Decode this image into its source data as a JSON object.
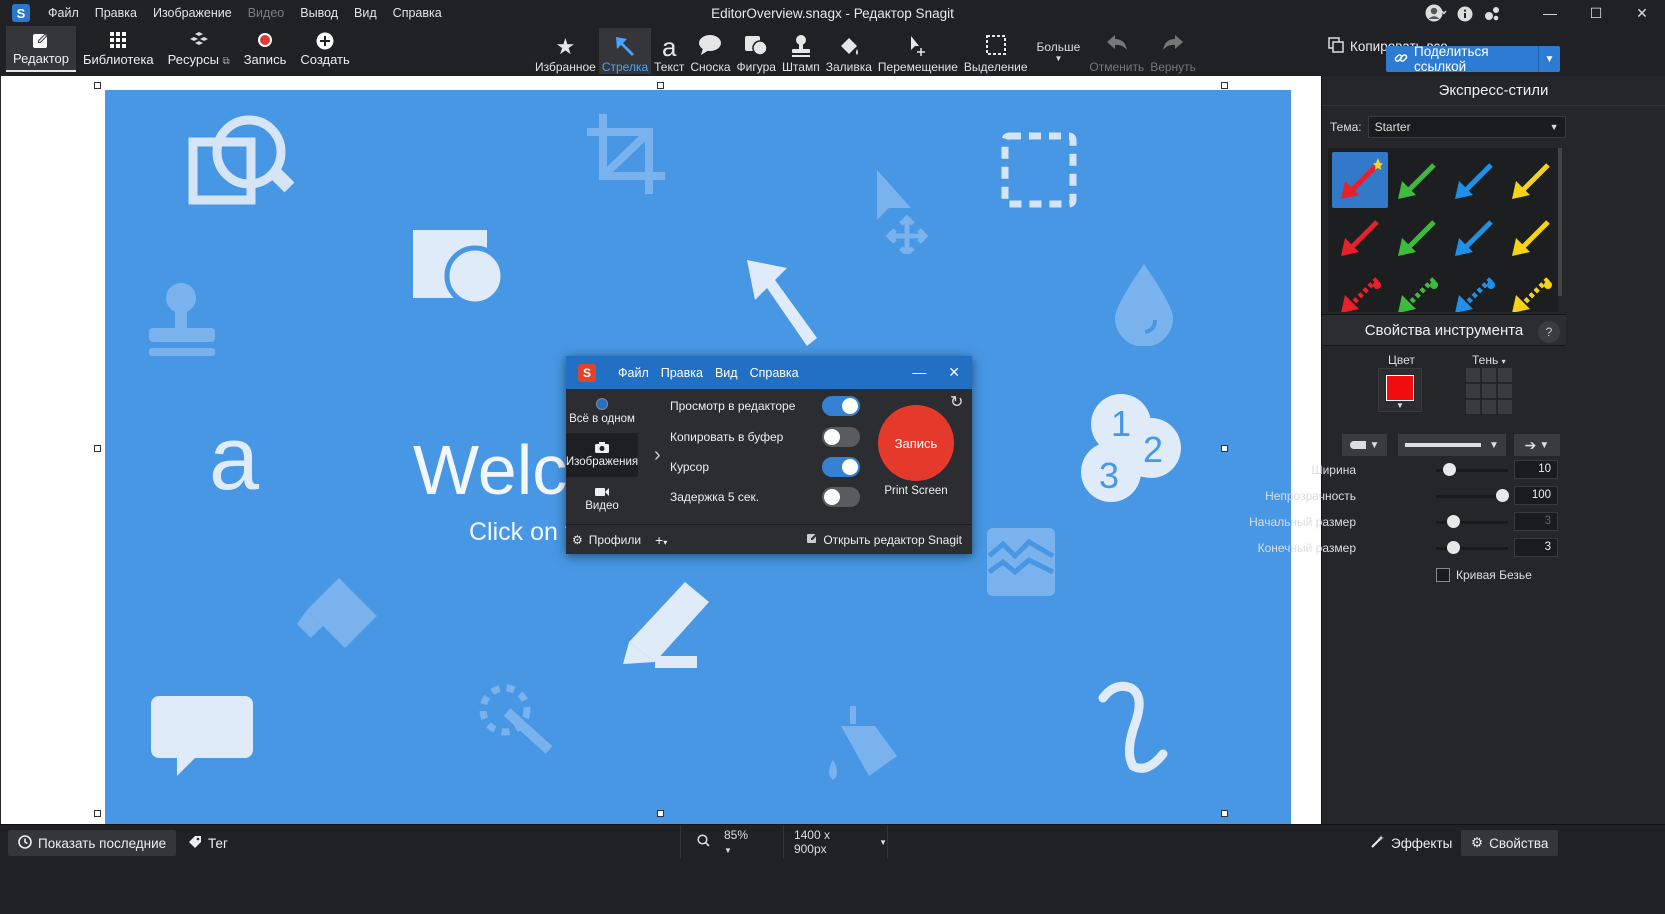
{
  "titlebar": {
    "app_logo": "S",
    "menu": [
      "Файл",
      "Правка",
      "Изображение",
      "Видео",
      "Вывод",
      "Вид",
      "Справка"
    ],
    "title": "EditorOverview.snagx - Редактор Snagit",
    "window_controls": {
      "minimize": "—",
      "maximize": "☐",
      "close": "✕"
    }
  },
  "nav": [
    {
      "label": "Редактор",
      "icon": "edit-icon"
    },
    {
      "label": "Библиотека",
      "icon": "grid-icon"
    },
    {
      "label": "Ресурсы",
      "icon": "resources-icon"
    },
    {
      "label": "Запись",
      "icon": "record-icon"
    },
    {
      "label": "Создать",
      "icon": "plus-icon"
    }
  ],
  "tools": [
    {
      "label": "Избранное",
      "icon": "star-icon"
    },
    {
      "label": "Стрелка",
      "icon": "arrow-icon",
      "active": true
    },
    {
      "label": "Текст",
      "icon": "text-icon"
    },
    {
      "label": "Сноска",
      "icon": "callout-icon"
    },
    {
      "label": "Фигура",
      "icon": "shape-icon"
    },
    {
      "label": "Штамп",
      "icon": "stamp-icon"
    },
    {
      "label": "Заливка",
      "icon": "fill-icon"
    },
    {
      "label": "Перемещение",
      "icon": "move-icon"
    },
    {
      "label": "Выделение",
      "icon": "selection-icon"
    }
  ],
  "more_label": "Больше",
  "undo_label": "Отменить",
  "redo_label": "Вернуть",
  "copy_all_label": "Копировать все",
  "share_label": "Поделиться ссылкой",
  "canvas": {
    "welcome": "Welco",
    "click_on": "Click on the"
  },
  "capture": {
    "menu": [
      "Файл",
      "Правка",
      "Вид",
      "Справка"
    ],
    "modes": [
      {
        "label": "Всё в одном",
        "icon": "all-in-one-icon"
      },
      {
        "label": "Изображения",
        "icon": "camera-icon"
      },
      {
        "label": "Видео",
        "icon": "video-icon"
      }
    ],
    "options": [
      {
        "label": "Просмотр в редакторе",
        "on": true
      },
      {
        "label": "Копировать в буфер",
        "on": false
      },
      {
        "label": "Курсор",
        "on": true
      },
      {
        "label": "Задержка 5 сек.",
        "on": false
      }
    ],
    "record_label": "Запись",
    "hotkey": "Print Screen",
    "profiles_label": "Профили",
    "add_label": "+",
    "open_editor_label": "Открыть редактор Snagit"
  },
  "right_panel": {
    "quick_styles_title": "Экспресс-стили",
    "theme_label": "Тема:",
    "theme_value": "Starter",
    "style_colors": [
      "#e8202a",
      "#3dbb3d",
      "#1e90e6",
      "#f5d317"
    ],
    "tool_props_title": "Свойства инструмента",
    "help": "?",
    "color_label": "Цвет",
    "color_value": "#f10d0d",
    "shadow_label": "Тень",
    "sliders": [
      {
        "label": "Ширина",
        "value": "10",
        "pos": 0.2,
        "dim": false
      },
      {
        "label": "Непрозрачность",
        "value": "100",
        "pos": 1.0,
        "dim": false
      },
      {
        "label": "Начальный размер",
        "value": "3",
        "pos": 0.25,
        "dim": true
      },
      {
        "label": "Конечный размер",
        "value": "3",
        "pos": 0.25,
        "dim": false
      }
    ],
    "bezier_label": "Кривая Безье"
  },
  "statusbar": {
    "recent_label": "Показать последние",
    "tag_label": "Тег",
    "zoom": "85%",
    "size": "1400 x 900px",
    "effects_label": "Эффекты",
    "properties_label": "Свойства"
  }
}
